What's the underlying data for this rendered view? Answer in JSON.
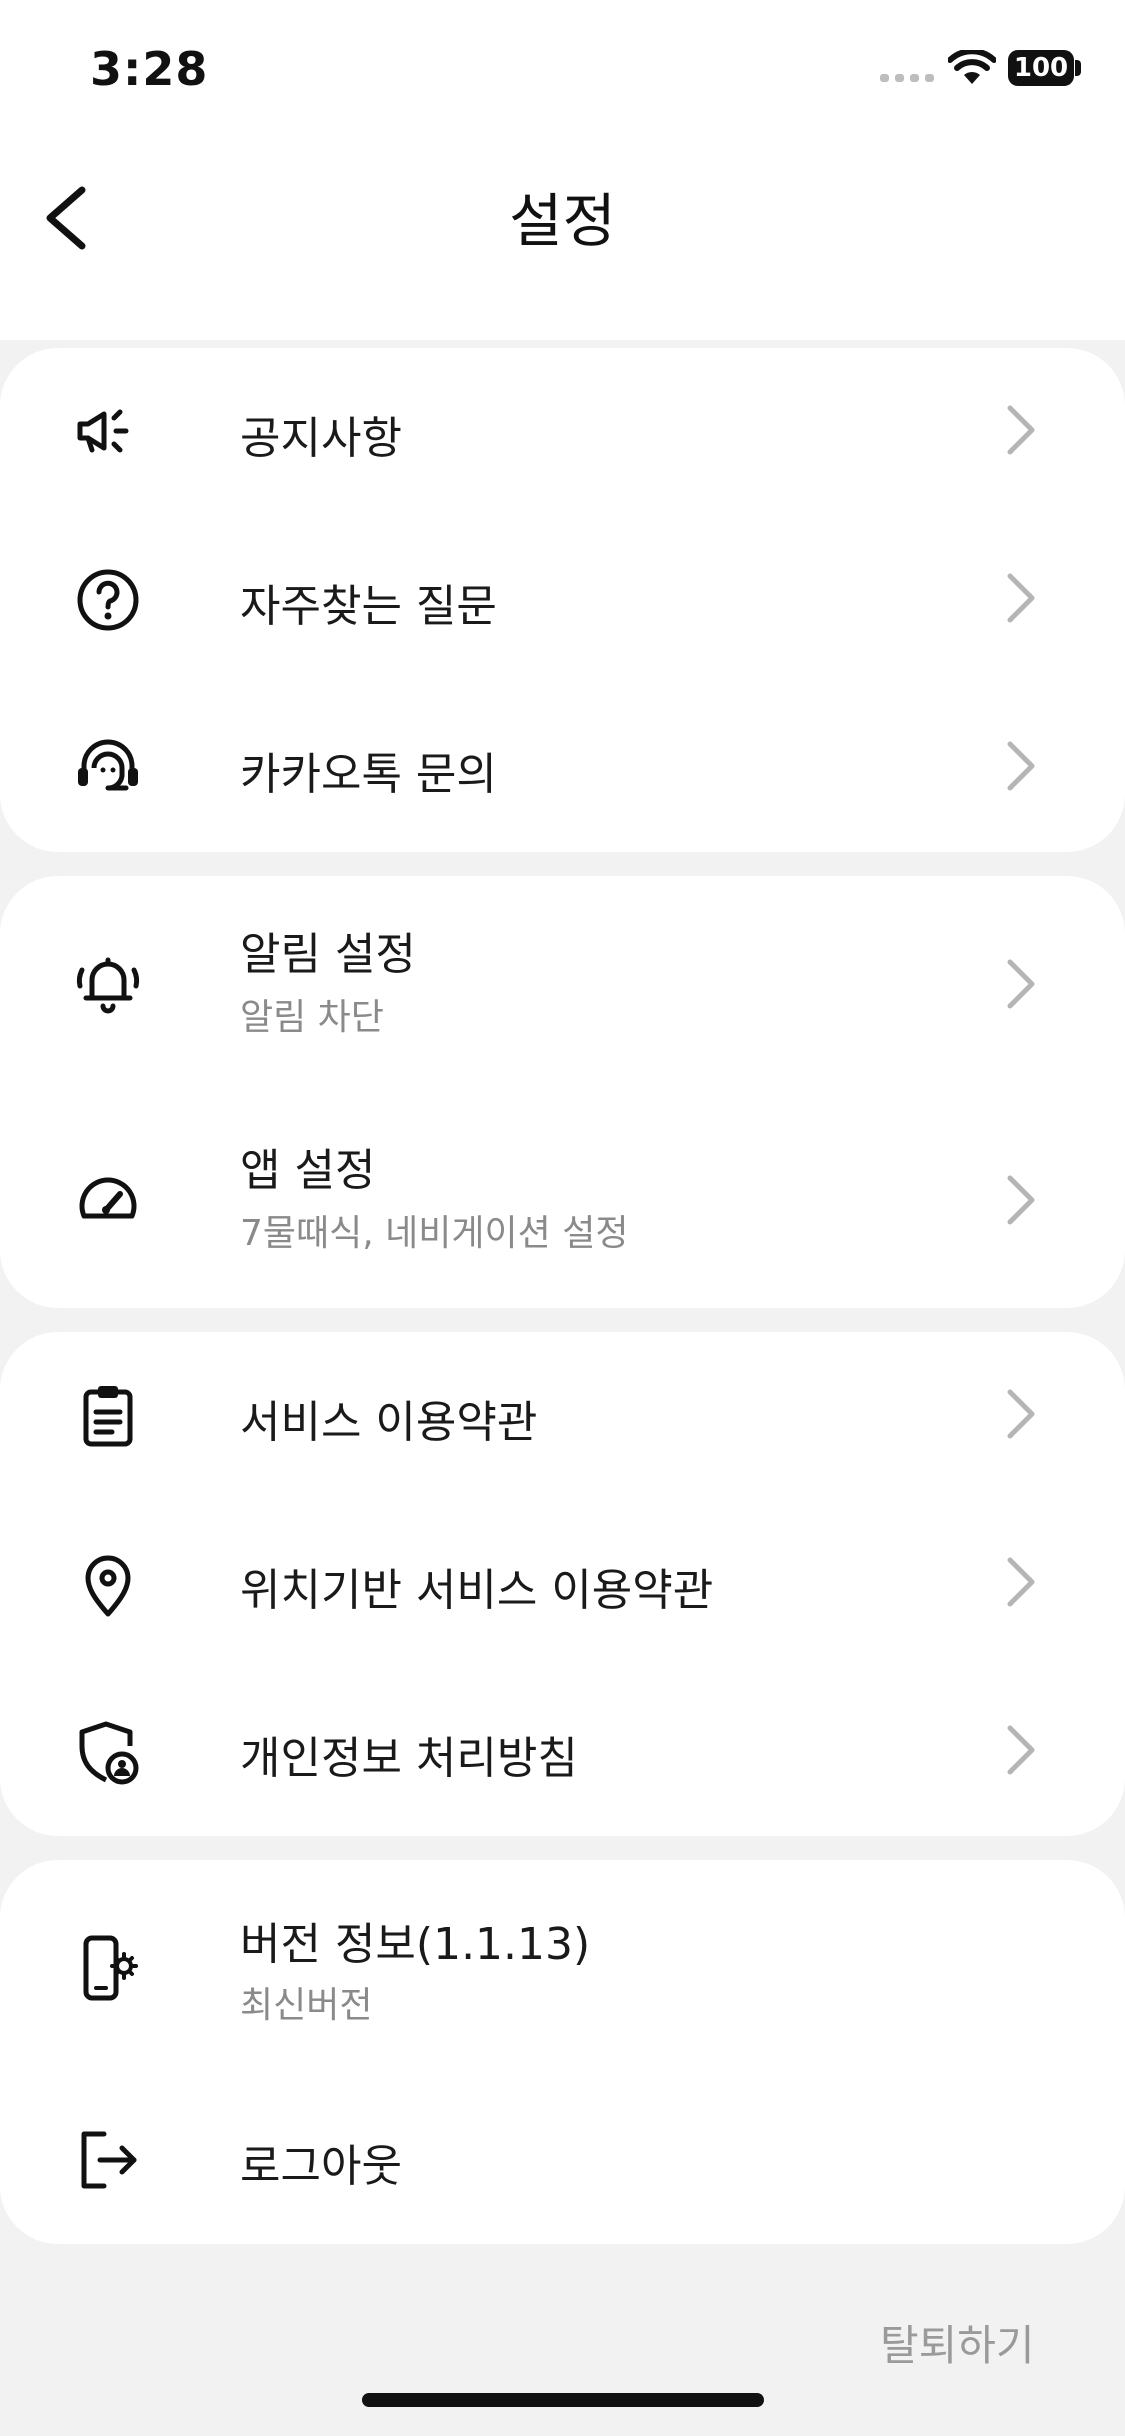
{
  "status_bar": {
    "time": "3:28",
    "battery": "100"
  },
  "header": {
    "title": "설정"
  },
  "groups": [
    {
      "items": [
        {
          "label": "공지사항",
          "icon": "megaphone-icon"
        },
        {
          "label": "자주찾는 질문",
          "icon": "question-circle-icon"
        },
        {
          "label": "카카오톡 문의",
          "icon": "headset-icon"
        }
      ]
    },
    {
      "items": [
        {
          "label": "알림 설정",
          "sublabel": "알림 차단",
          "icon": "bell-icon"
        },
        {
          "label": "앱 설정",
          "sublabel": "7물때식, 네비게이션 설정",
          "icon": "speedometer-icon"
        }
      ]
    },
    {
      "items": [
        {
          "label": "서비스 이용약관",
          "icon": "clipboard-icon"
        },
        {
          "label": "위치기반 서비스 이용약관",
          "icon": "location-pin-icon"
        },
        {
          "label": "개인정보 처리방침",
          "icon": "shield-user-icon"
        }
      ]
    },
    {
      "items": [
        {
          "label": "버전 정보(1.1.13)",
          "sublabel": "최신버전",
          "icon": "phone-settings-icon"
        },
        {
          "label": "로그아웃",
          "icon": "logout-icon"
        }
      ]
    }
  ],
  "footer": {
    "withdraw_label": "탈퇴하기"
  },
  "colors": {
    "background": "#f2f2f2",
    "card": "#ffffff",
    "chevron": "#b5b5b5",
    "sublabel": "#8a8a8a"
  }
}
